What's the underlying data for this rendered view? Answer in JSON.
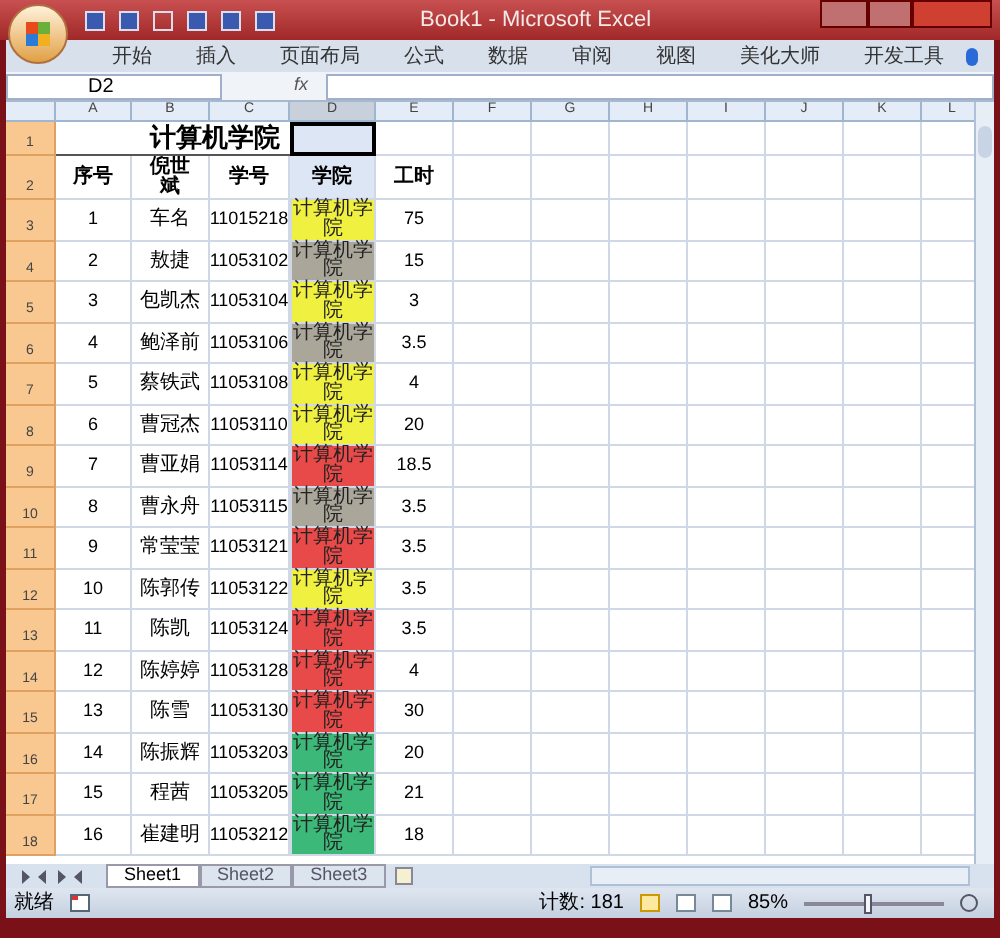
{
  "window": {
    "title": "Book1 - Microsoft Excel"
  },
  "ribbon_tabs": [
    "开始",
    "插入",
    "页面布局",
    "公式",
    "数据",
    "审阅",
    "视图",
    "美化大师",
    "开发工具"
  ],
  "formula_bar": {
    "name_box": "D2",
    "fx": "fx"
  },
  "columns": [
    "A",
    "B",
    "C",
    "D",
    "E",
    "F",
    "G",
    "H",
    "I",
    "J",
    "K",
    "L"
  ],
  "title_row": "1",
  "title_cell": "计算机学院",
  "header": {
    "row": "2",
    "cells": [
      "序号",
      "倪世斌",
      "学号",
      "学院",
      "工时"
    ]
  },
  "rows": [
    {
      "row": "3",
      "no": "1",
      "name": "车名",
      "id": "11015218",
      "college": "计算机学院",
      "color": "#f0f040",
      "hours": "75"
    },
    {
      "row": "4",
      "no": "2",
      "name": "敖捷",
      "id": "11053102",
      "college": "计算机学院",
      "color": "#aaa79a",
      "hours": "15"
    },
    {
      "row": "5",
      "no": "3",
      "name": "包凯杰",
      "id": "11053104",
      "college": "计算机学院",
      "color": "#f0f040",
      "hours": "3"
    },
    {
      "row": "6",
      "no": "4",
      "name": "鲍泽前",
      "id": "11053106",
      "college": "计算机学院",
      "color": "#aaa79a",
      "hours": "3.5"
    },
    {
      "row": "7",
      "no": "5",
      "name": "蔡铁武",
      "id": "11053108",
      "college": "计算机学院",
      "color": "#f0f040",
      "hours": "4"
    },
    {
      "row": "8",
      "no": "6",
      "name": "曹冠杰",
      "id": "11053110",
      "college": "计算机学院",
      "color": "#f0f040",
      "hours": "20"
    },
    {
      "row": "9",
      "no": "7",
      "name": "曹亚娟",
      "id": "11053114",
      "college": "计算机学院",
      "color": "#e84a4a",
      "hours": "18.5"
    },
    {
      "row": "10",
      "no": "8",
      "name": "曹永舟",
      "id": "11053115",
      "college": "计算机学院",
      "color": "#aaa79a",
      "hours": "3.5"
    },
    {
      "row": "11",
      "no": "9",
      "name": "常莹莹",
      "id": "11053121",
      "college": "计算机学院",
      "color": "#e84a4a",
      "hours": "3.5"
    },
    {
      "row": "12",
      "no": "10",
      "name": "陈郭传",
      "id": "11053122",
      "college": "计算机学院",
      "color": "#f0f040",
      "hours": "3.5"
    },
    {
      "row": "13",
      "no": "11",
      "name": "陈凯",
      "id": "11053124",
      "college": "计算机学院",
      "color": "#e84a4a",
      "hours": "3.5"
    },
    {
      "row": "14",
      "no": "12",
      "name": "陈婷婷",
      "id": "11053128",
      "college": "计算机学院",
      "color": "#e84a4a",
      "hours": "4"
    },
    {
      "row": "15",
      "no": "13",
      "name": "陈雪",
      "id": "11053130",
      "college": "计算机学院",
      "color": "#e84a4a",
      "hours": "30"
    },
    {
      "row": "16",
      "no": "14",
      "name": "陈振辉",
      "id": "11053203",
      "college": "计算机学院",
      "color": "#3cb878",
      "hours": "20"
    },
    {
      "row": "17",
      "no": "15",
      "name": "程茜",
      "id": "11053205",
      "college": "计算机学院",
      "color": "#3cb878",
      "hours": "21"
    },
    {
      "row": "18",
      "no": "16",
      "name": "崔建明",
      "id": "11053212",
      "college": "计算机学院",
      "color": "#3cb878",
      "hours": "18"
    }
  ],
  "sheet_tabs": [
    {
      "label": "Sheet1",
      "selected": true
    },
    {
      "label": "Sheet2",
      "selected": false
    },
    {
      "label": "Sheet3",
      "selected": false
    }
  ],
  "status_bar": {
    "state": "就绪",
    "count": "计数: 181",
    "zoom": "85%",
    "zoom_slider": {
      "level": 0.45
    }
  }
}
